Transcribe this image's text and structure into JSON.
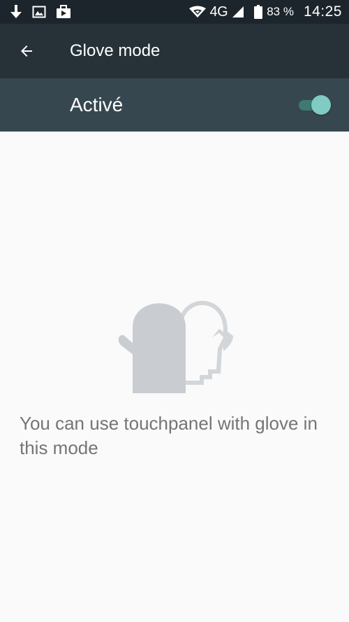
{
  "status_bar": {
    "icons": [
      "download-icon",
      "image-icon",
      "bag-icon"
    ],
    "network": "4G",
    "battery_percent": "83 %",
    "time": "14:25"
  },
  "toolbar": {
    "title": "Glove mode",
    "back_icon": "arrow-back-icon"
  },
  "master_switch": {
    "label": "Activé",
    "checked": true,
    "accent_color": "#80cbc4"
  },
  "content": {
    "illustration_icon": "glove-icon",
    "description": "You can use touchpanel with glove in this mode"
  }
}
